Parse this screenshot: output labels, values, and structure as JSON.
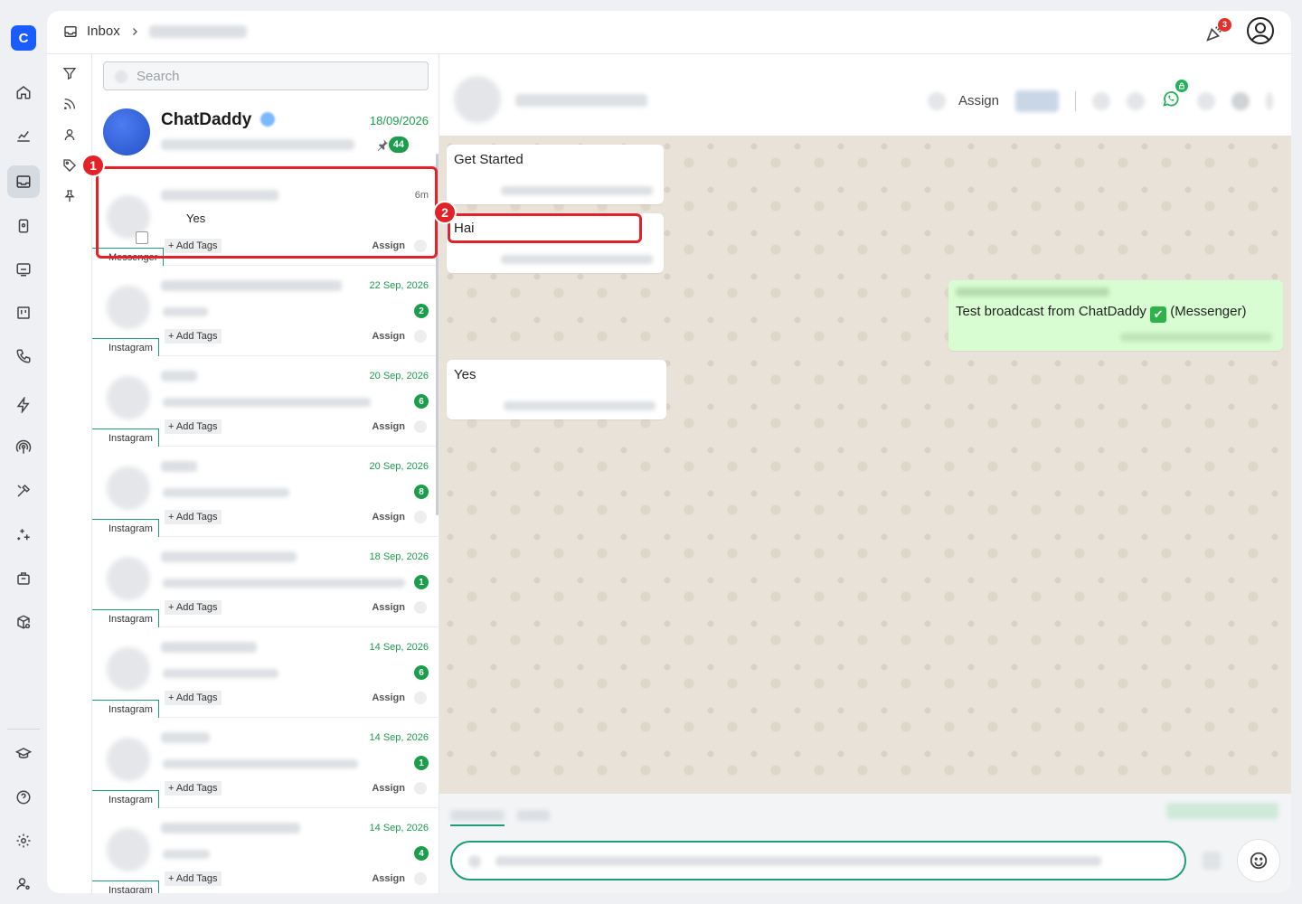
{
  "app": {
    "logo_letter": "C",
    "brand_color": "#1a5cff",
    "accent": "#1a9e4c"
  },
  "nav": {
    "items": [
      "home-icon",
      "analytics-icon",
      "inbox-icon",
      "contacts-card-icon",
      "broadcast-screen-icon",
      "kanban-icon",
      "phone-icon",
      "bolt-icon",
      "podcast-icon",
      "tools-icon",
      "sparkle-icon",
      "briefcase-icon",
      "package-settings-icon"
    ],
    "bottom": [
      "academy-icon",
      "help-icon",
      "settings-icon",
      "user-settings-icon"
    ],
    "active": "inbox-icon"
  },
  "topbar": {
    "breadcrumb_root": "Inbox",
    "notifications_count": "3"
  },
  "filters": [
    "filter-icon",
    "rss-icon",
    "person-icon",
    "tag-icon",
    "pin-icon"
  ],
  "search": {
    "placeholder": "Search"
  },
  "pinned_chat": {
    "name": "ChatDaddy",
    "date": "18/09/2026",
    "unread": "44"
  },
  "chats": [
    {
      "time": "6m",
      "message": "Yes",
      "add_tags": "+ Add Tags",
      "assign": "Assign",
      "channel": "Messenger",
      "selected": true
    },
    {
      "date": "22 Sep, 2026",
      "unread": "2",
      "add_tags": "+ Add Tags",
      "assign": "Assign",
      "channel": "Instagram"
    },
    {
      "date": "20 Sep, 2026",
      "unread": "6",
      "add_tags": "+ Add Tags",
      "assign": "Assign",
      "channel": "Instagram"
    },
    {
      "date": "20 Sep, 2026",
      "unread": "8",
      "add_tags": "+ Add Tags",
      "assign": "Assign",
      "channel": "Instagram"
    },
    {
      "date": "18 Sep, 2026",
      "unread": "1",
      "add_tags": "+ Add Tags",
      "assign": "Assign",
      "channel": "Instagram"
    },
    {
      "date": "14 Sep, 2026",
      "unread": "6",
      "add_tags": "+ Add Tags",
      "assign": "Assign",
      "channel": "Instagram"
    },
    {
      "date": "14 Sep, 2026",
      "unread": "1",
      "add_tags": "+ Add Tags",
      "assign": "Assign",
      "channel": "Instagram"
    },
    {
      "date": "14 Sep, 2026",
      "unread": "4",
      "add_tags": "+ Add Tags",
      "assign": "Assign",
      "channel": "Instagram"
    }
  ],
  "chat_header": {
    "assign_label": "Assign"
  },
  "messages": [
    {
      "text": "Get Started",
      "direction": "in"
    },
    {
      "text": "Hai",
      "direction": "in"
    },
    {
      "text_before": "Test broadcast from ChatDaddy",
      "text_after": "(Messenger)",
      "direction": "out"
    },
    {
      "text": "Yes",
      "direction": "in"
    }
  ],
  "annotations": [
    "1",
    "2"
  ],
  "annotation_color": "#e32228"
}
